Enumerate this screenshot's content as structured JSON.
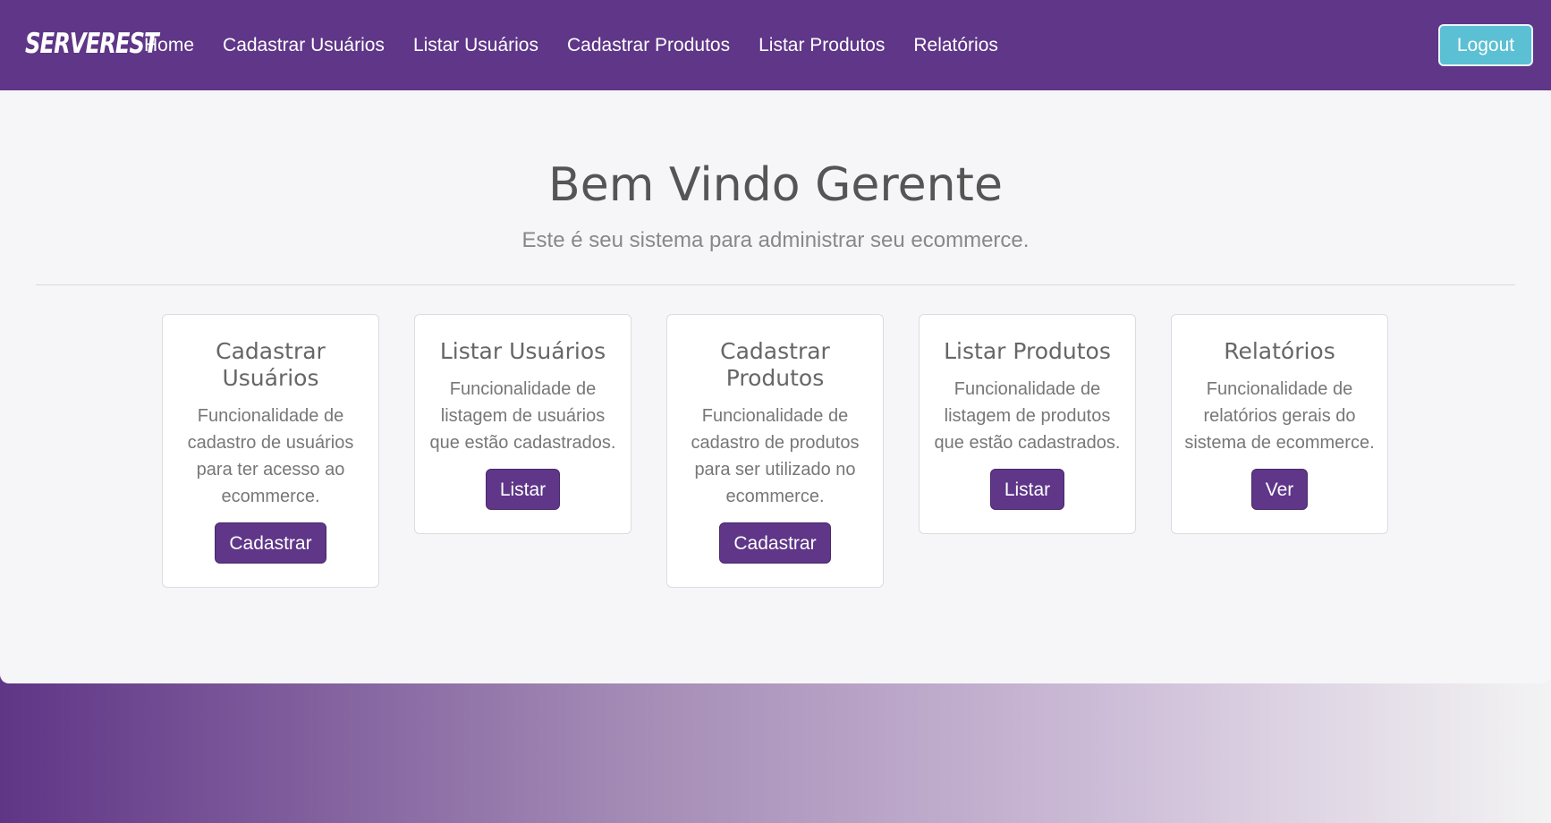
{
  "nav": {
    "logo": "SERVEREST",
    "links": [
      "Home",
      "Cadastrar Usuários",
      "Listar Usuários",
      "Cadastrar Produtos",
      "Listar Produtos",
      "Relatórios"
    ],
    "logout": "Logout"
  },
  "hero": {
    "title": "Bem Vindo Gerente",
    "subtitle": "Este é seu sistema para administrar seu ecommerce."
  },
  "cards": [
    {
      "title": "Cadastrar Usuários",
      "text": "Funcionalidade de cadastro de usuários para ter acesso ao ecommerce.",
      "button": "Cadastrar"
    },
    {
      "title": "Listar Usuários",
      "text": "Funcionalidade de listagem de usuários que estão cadastrados.",
      "button": "Listar"
    },
    {
      "title": "Cadastrar Produtos",
      "text": "Funcionalidade de cadastro de produtos para ser utilizado no ecommerce.",
      "button": "Cadastrar"
    },
    {
      "title": "Listar Produtos",
      "text": "Funcionalidade de listagem de produtos que estão cadastrados.",
      "button": "Listar"
    },
    {
      "title": "Relatórios",
      "text": "Funcionalidade de relatórios gerais do sistema de ecommerce.",
      "button": "Ver"
    }
  ],
  "colors": {
    "brand": "#5f3688",
    "logout": "#5bc0d3"
  }
}
